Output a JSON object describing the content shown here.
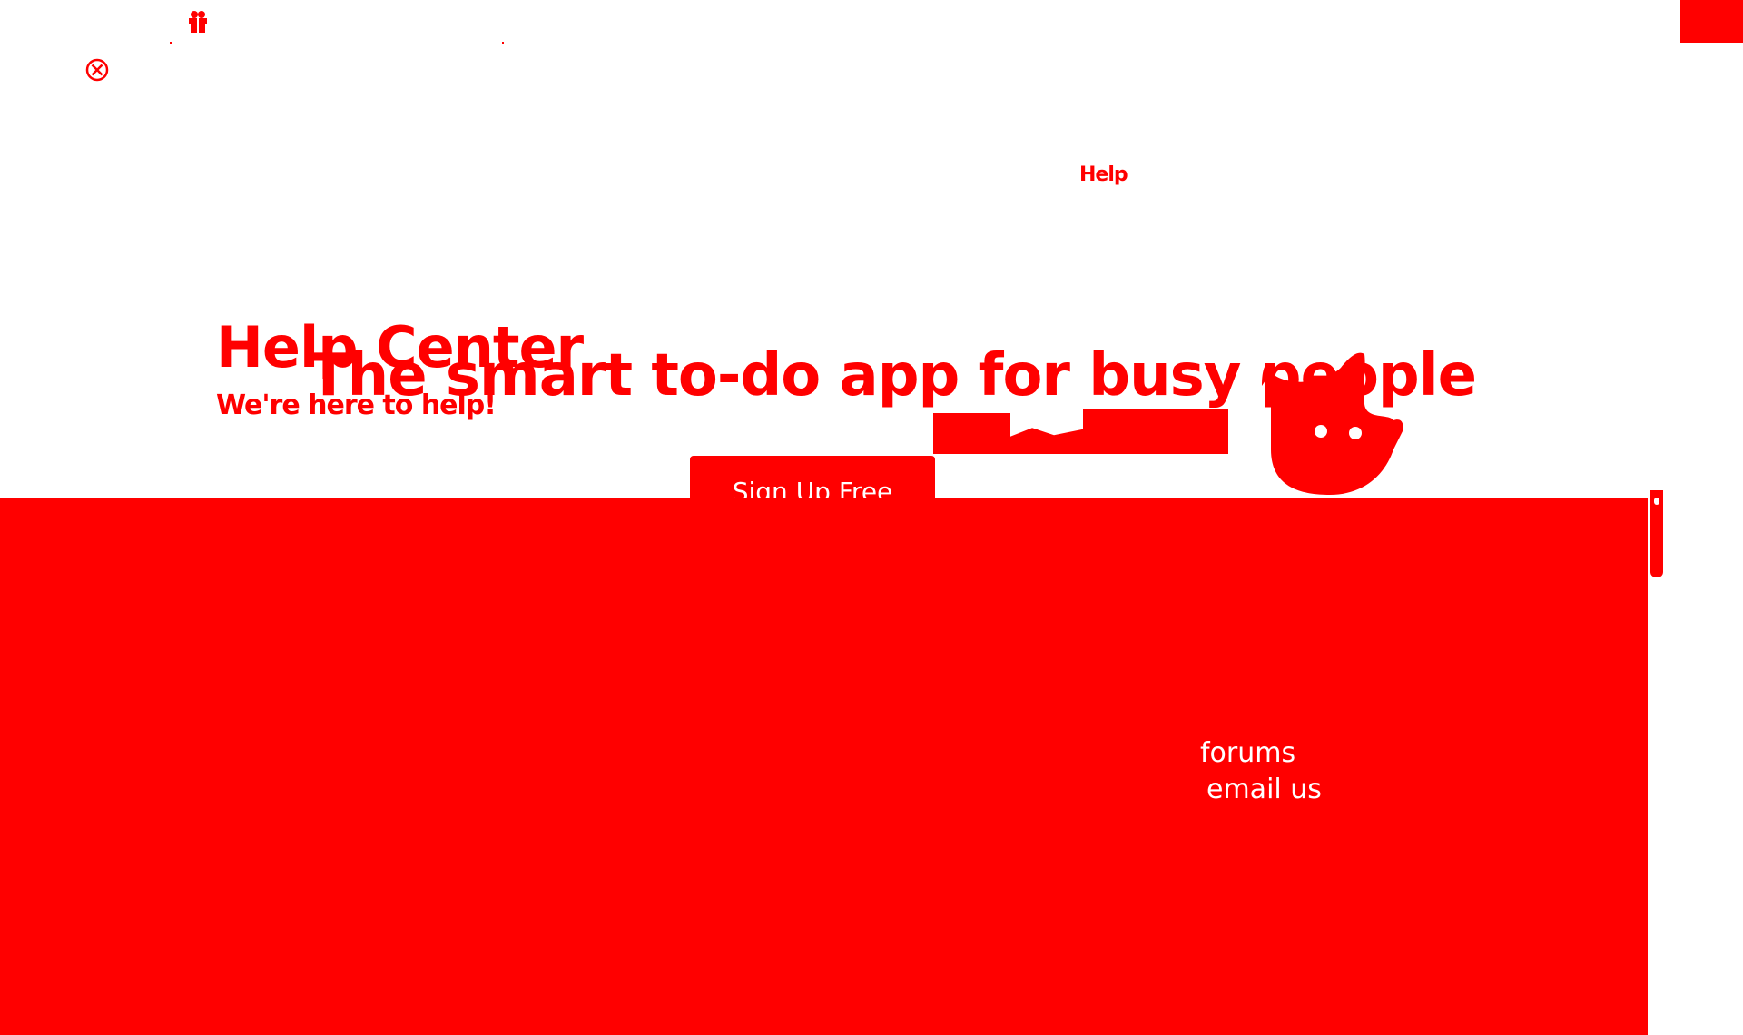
{
  "nav": {
    "help_label": "Help"
  },
  "help_center": {
    "title": "Help Center",
    "subtitle": "We're here to help!"
  },
  "hero": {
    "title": "The smart to-do app for busy people",
    "signup_label": "Sign Up Free"
  },
  "footer": {
    "forums_label": "forums",
    "email_label": "email us"
  },
  "icons": {
    "badge": "gift-icon",
    "close": "close-circle-icon",
    "mascot": "cow-mascot-icon"
  },
  "colors": {
    "accent": "#ff0000",
    "background": "#ffffff"
  }
}
